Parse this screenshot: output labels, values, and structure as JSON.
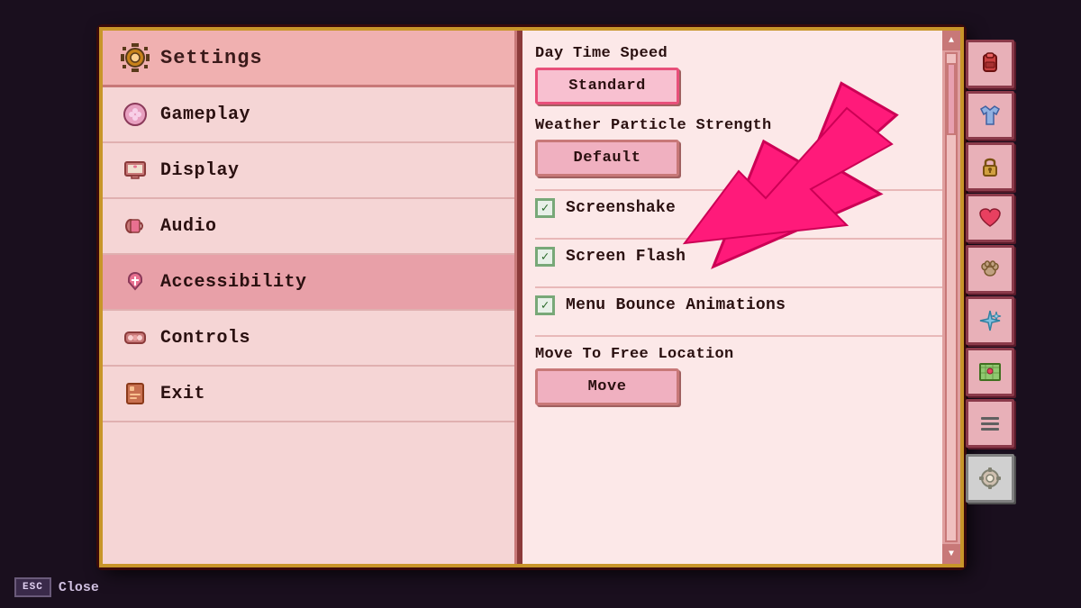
{
  "app": {
    "title": "Settings"
  },
  "header": {
    "title": "Settings",
    "gear_icon": "⚙"
  },
  "menu": {
    "items": [
      {
        "id": "gameplay",
        "label": "Gameplay",
        "icon": "🎮",
        "active": false
      },
      {
        "id": "display",
        "label": "Display",
        "icon": "📺",
        "active": false
      },
      {
        "id": "audio",
        "label": "Audio",
        "icon": "🎵",
        "active": false
      },
      {
        "id": "accessibility",
        "label": "Accessibility",
        "icon": "💗",
        "active": true
      },
      {
        "id": "controls",
        "label": "Controls",
        "icon": "🎮",
        "active": false
      },
      {
        "id": "exit",
        "label": "Exit",
        "icon": "📕",
        "active": false
      }
    ]
  },
  "content": {
    "settings": [
      {
        "type": "button-setting",
        "label": "Day Time Speed",
        "value": "Standard",
        "highlighted": true
      },
      {
        "type": "button-setting",
        "label": "Weather Particle Strength",
        "value": "Default",
        "highlighted": false
      },
      {
        "type": "checkbox",
        "label": "Screenshake",
        "checked": true
      },
      {
        "type": "checkbox",
        "label": "Screen Flash",
        "checked": true
      },
      {
        "type": "checkbox",
        "label": "Menu Bounce Animations",
        "checked": true
      },
      {
        "type": "button-setting",
        "label": "Move To Free Location",
        "value": "Move",
        "highlighted": false
      }
    ]
  },
  "right_sidebar": {
    "icons": [
      "🎒",
      "👕",
      "🔒",
      "❤️",
      "🐾",
      "✨",
      "🗺️",
      "📟"
    ]
  },
  "footer": {
    "esc_label": "ESC",
    "close_label": "Close"
  }
}
